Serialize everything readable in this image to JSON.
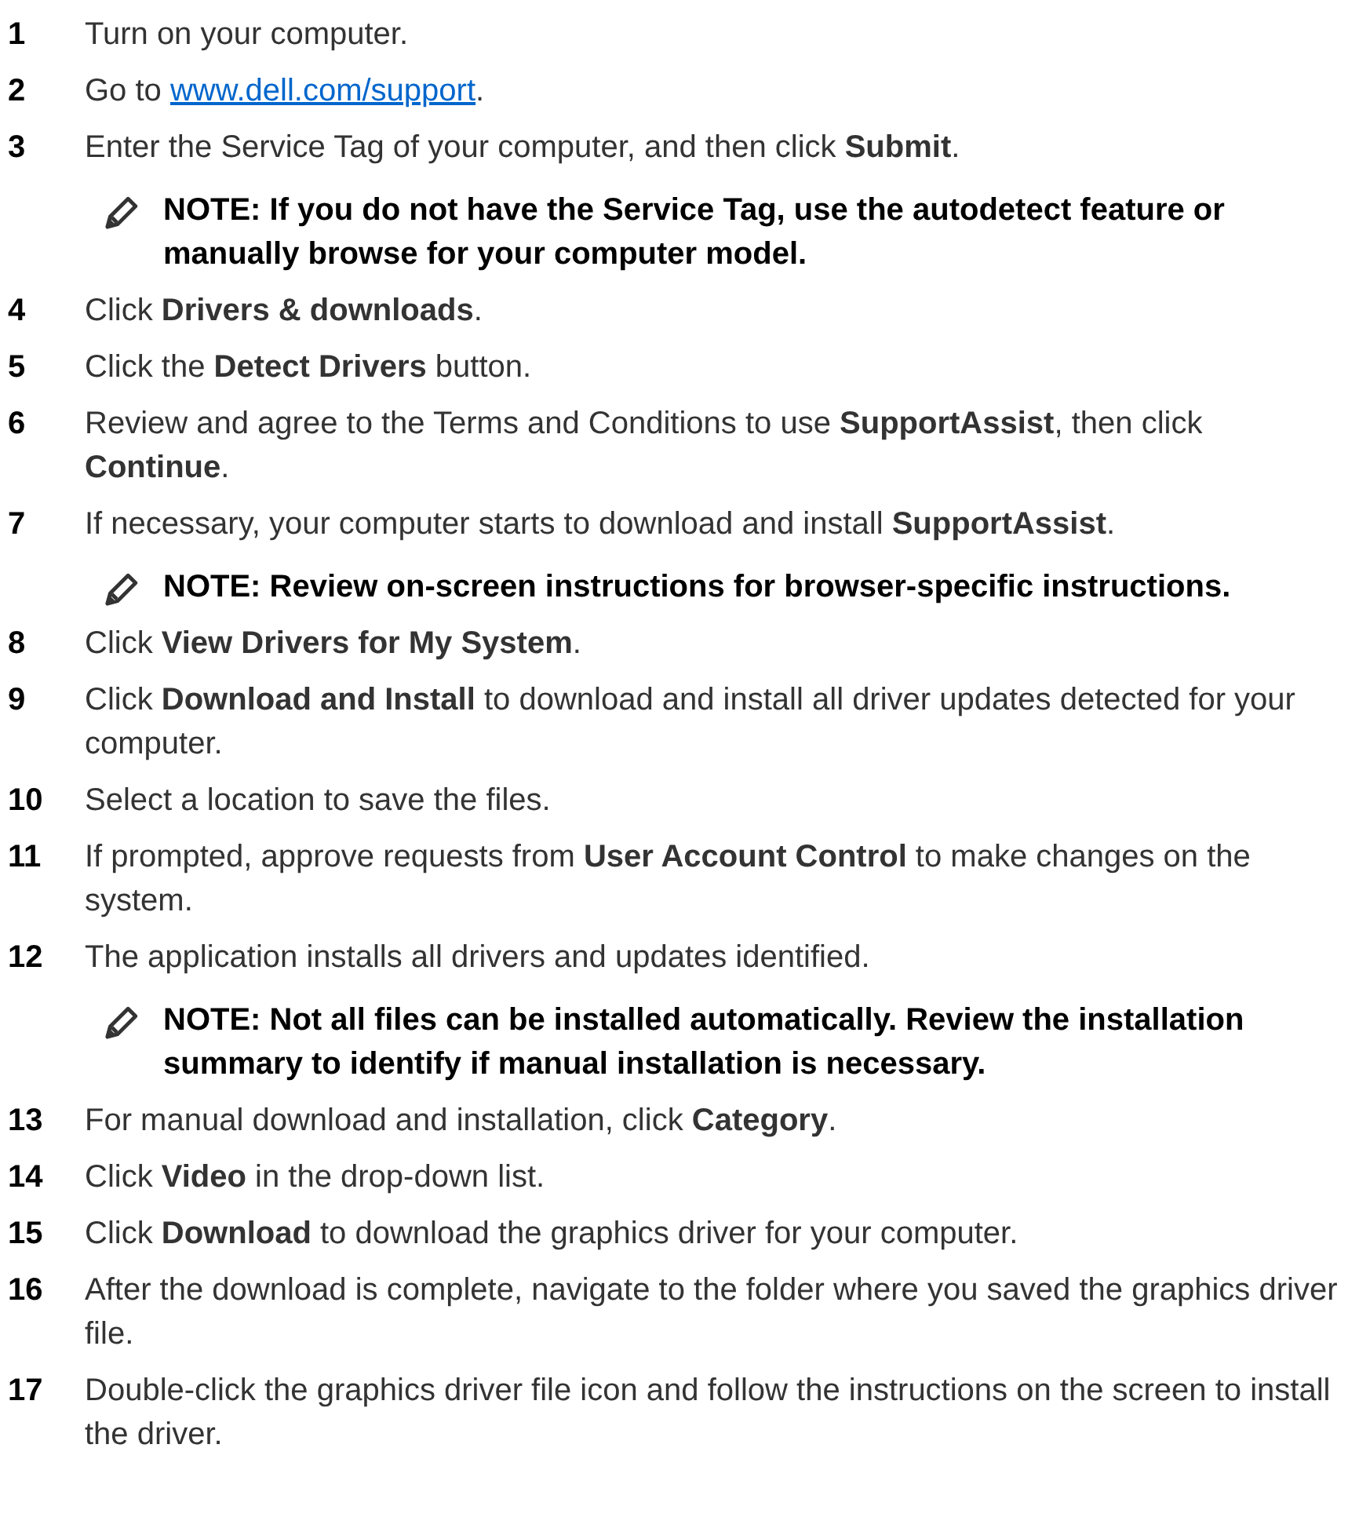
{
  "items": [
    {
      "kind": "step",
      "number": "1",
      "text": "Turn on your computer."
    },
    {
      "kind": "step",
      "number": "2",
      "text": "Go to ",
      "link": "www.dell.com/support",
      "after": "."
    },
    {
      "kind": "step",
      "number": "3",
      "text": "Enter the Service Tag of your computer, and then click **Submit**."
    },
    {
      "kind": "note",
      "text": "**NOTE: If you do not have the Service Tag, use the autodetect feature or manually browse for your computer model.**"
    },
    {
      "kind": "step",
      "number": "4",
      "text": "Click **Drivers & downloads**."
    },
    {
      "kind": "step",
      "number": "5",
      "text": "Click the **Detect Drivers** button."
    },
    {
      "kind": "step",
      "number": "6",
      "text": "Review and agree to the Terms and Conditions to use **SupportAssist**, then click **Continue**."
    },
    {
      "kind": "step",
      "number": "7",
      "text": "If necessary, your computer starts to download and install **SupportAssist**."
    },
    {
      "kind": "note",
      "text": "**NOTE: Review on-screen instructions for browser-specific instructions.**"
    },
    {
      "kind": "step",
      "number": "8",
      "text": "Click **View Drivers for My System**."
    },
    {
      "kind": "step",
      "number": "9",
      "text": "Click **Download and Install** to download and install all driver updates detected for your computer."
    },
    {
      "kind": "step",
      "number": "10",
      "text": "Select a location to save the files."
    },
    {
      "kind": "step",
      "number": "11",
      "text": "If prompted, approve requests from **User Account Control** to make changes on the system."
    },
    {
      "kind": "step",
      "number": "12",
      "text": "The application installs all drivers and updates identified."
    },
    {
      "kind": "note",
      "text": "**NOTE: Not all files can be installed automatically. Review the installation summary to identify if manual installation is necessary.**"
    },
    {
      "kind": "step",
      "number": "13",
      "text": "For manual download and installation, click **Category**."
    },
    {
      "kind": "step",
      "number": "14",
      "text": "Click **Video** in the drop-down list."
    },
    {
      "kind": "step",
      "number": "15",
      "text": "Click **Download** to download the graphics driver for your computer."
    },
    {
      "kind": "step",
      "number": "16",
      "text": "After the download is complete, navigate to the folder where you saved the graphics driver file."
    },
    {
      "kind": "step",
      "number": "17",
      "text": "Double-click the graphics driver file icon and follow the instructions on the screen to install the driver."
    }
  ]
}
